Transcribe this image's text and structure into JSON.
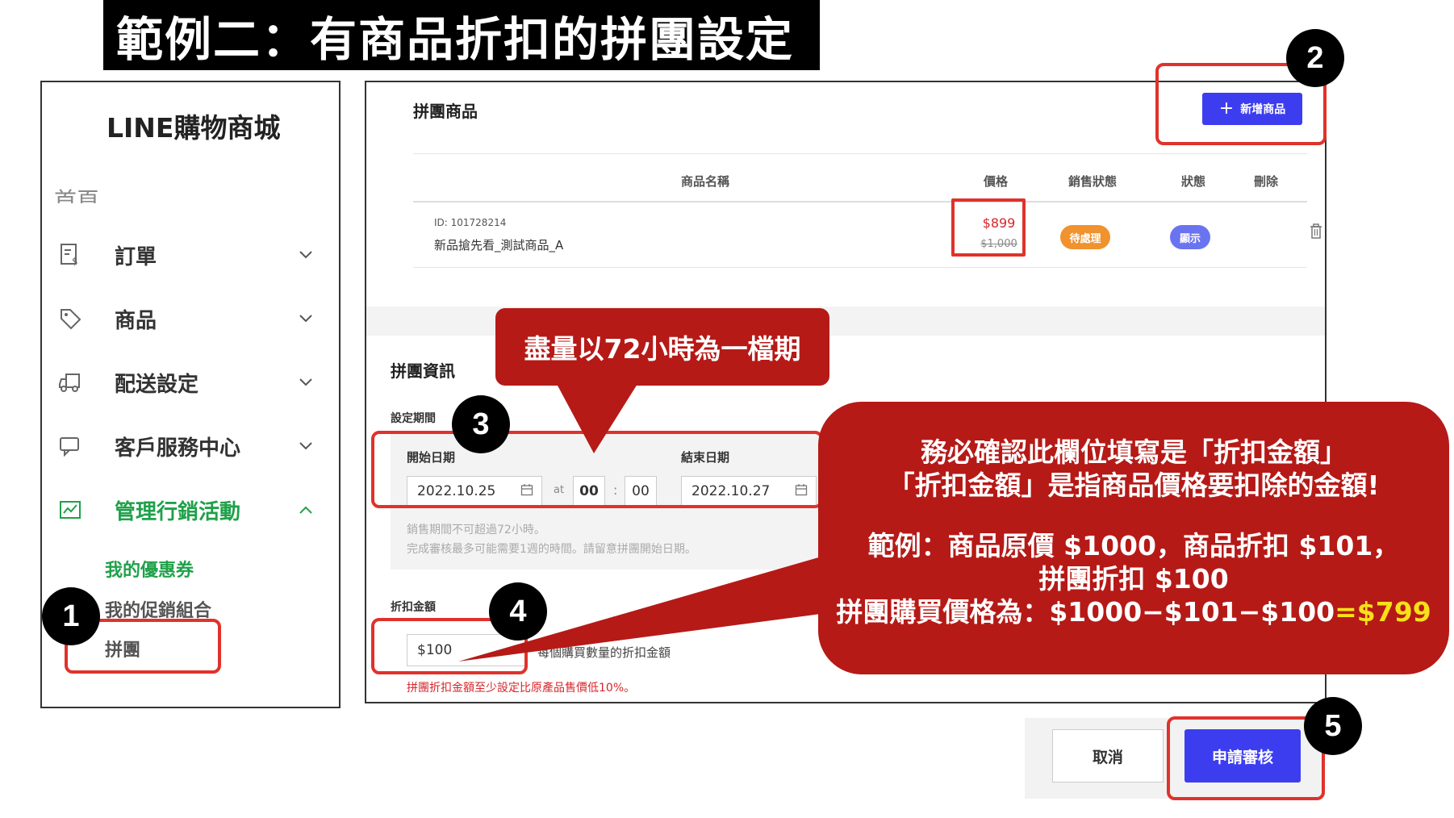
{
  "title": "範例二：有商品折扣的拼團設定",
  "sidebar": {
    "brand": "LINE購物商城",
    "cut_item": "首頁",
    "items": [
      {
        "label": "訂單",
        "icon": "order-icon",
        "expanded": false
      },
      {
        "label": "商品",
        "icon": "tag-icon",
        "expanded": false
      },
      {
        "label": "配送設定",
        "icon": "truck-icon",
        "expanded": false
      },
      {
        "label": "客戶服務中心",
        "icon": "chat-icon",
        "expanded": false
      },
      {
        "label": "管理行銷活動",
        "icon": "marketing-icon",
        "expanded": true
      }
    ],
    "sub_items": [
      {
        "label": "我的優惠券",
        "active": true
      },
      {
        "label": "我的促銷組合",
        "active": false
      },
      {
        "label": "拼團",
        "active": false
      }
    ]
  },
  "products": {
    "section_title": "拼團商品",
    "add_button": "新增商品",
    "columns": [
      "商品名稱",
      "價格",
      "銷售狀態",
      "狀態",
      "刪除"
    ],
    "rows": [
      {
        "id": "ID: 101728214",
        "name": "新品搶先看_測試商品_A",
        "price": "$899",
        "original_price": "$1,000",
        "sale_status": "待處理",
        "status": "顯示"
      }
    ]
  },
  "group_info": {
    "section_title": "拼團資訊",
    "period_label": "設定期間",
    "start_label": "開始日期",
    "start_date": "2022.10.25",
    "at_label": "at",
    "start_hour": "00",
    "time_sep": ":",
    "start_minute": "00",
    "end_label": "結束日期",
    "end_date": "2022.10.27",
    "hint1": "銷售期間不可超過72小時。",
    "hint2": "完成審核最多可能需要1週的時間。請留意拼團開始日期。",
    "discount_label": "折扣金額",
    "discount_value": "$100",
    "discount_desc": "每個購買數量的折扣金額",
    "discount_error": "拼團折扣金額至少設定比原產品售價低10%。"
  },
  "buttons": {
    "cancel": "取消",
    "submit": "申請審核"
  },
  "badges": [
    "1",
    "2",
    "3",
    "4",
    "5"
  ],
  "callouts": {
    "period": "盡量以72小時為一檔期",
    "discount_line1": "務必確認此欄位填寫是「折扣金額」",
    "discount_line2": "「折扣金額」是指商品價格要扣除的金額!",
    "example_line1": "範例：商品原價 $1000，商品折扣 $101，",
    "example_line2": "拼團折扣 $100",
    "example_line3_prefix": "拼團購買價格為：$1000−$101−$100",
    "example_line3_result": "=$799"
  },
  "colors": {
    "accent_blue": "#3d3df0",
    "sidebar_active_green": "#1fa14a",
    "highlight_red": "#e0322b",
    "callout_red": "#b51a17",
    "price_red": "#d6262b",
    "pending_orange": "#f0922e",
    "show_purple": "#6a73f0",
    "result_yellow": "#f7e01a"
  }
}
